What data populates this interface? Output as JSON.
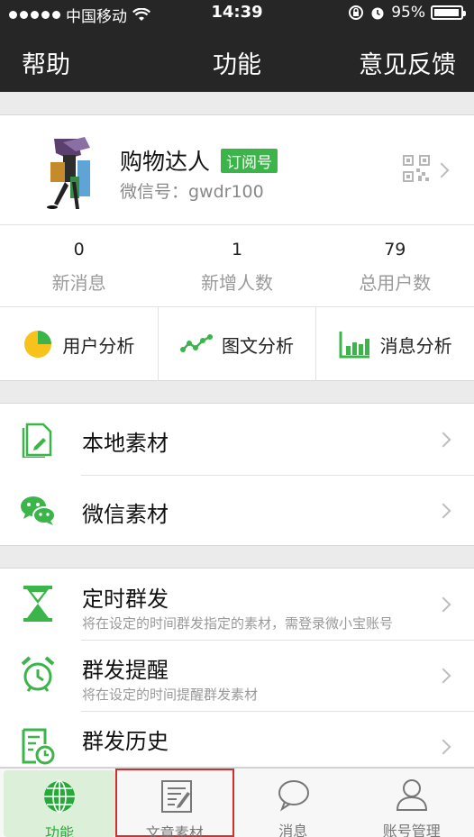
{
  "status_bar": {
    "carrier": "中国移动",
    "time": "14:39",
    "battery": "95%",
    "battery_level": 0.95
  },
  "nav": {
    "left": "帮助",
    "title": "功能",
    "right": "意见反馈"
  },
  "account": {
    "name": "购物达人",
    "badge": "订阅号",
    "wechat_id": "微信号：gwdr100"
  },
  "stats": [
    {
      "value": "0",
      "label": "新消息"
    },
    {
      "value": "1",
      "label": "新增人数"
    },
    {
      "value": "79",
      "label": "总用户数"
    }
  ],
  "analysis": [
    {
      "label": "用户分析",
      "icon": "pie-chart-icon"
    },
    {
      "label": "图文分析",
      "icon": "line-chart-icon"
    },
    {
      "label": "消息分析",
      "icon": "bar-chart-icon"
    }
  ],
  "materials": [
    {
      "label": "本地素材",
      "icon": "document-edit-icon"
    },
    {
      "label": "微信素材",
      "icon": "wechat-icon"
    }
  ],
  "tasks": [
    {
      "label": "定时群发",
      "sub": "将在设定的时间群发指定的素材，需登录微小宝账号",
      "icon": "hourglass-icon"
    },
    {
      "label": "群发提醒",
      "sub": "将在设定的时间提醒群发素材",
      "icon": "alarm-clock-icon"
    },
    {
      "label": "群发历史",
      "sub": "",
      "icon": "history-icon"
    }
  ],
  "tabs": [
    {
      "label": "功能",
      "icon": "globe-icon"
    },
    {
      "label": "文章素材",
      "icon": "article-icon"
    },
    {
      "label": "消息",
      "icon": "chat-bubble-icon"
    },
    {
      "label": "账号管理",
      "icon": "user-icon"
    }
  ],
  "colors": {
    "accent_green": "#3bb54a",
    "nav_bg": "#262626",
    "highlight_red": "#d32f2f"
  }
}
